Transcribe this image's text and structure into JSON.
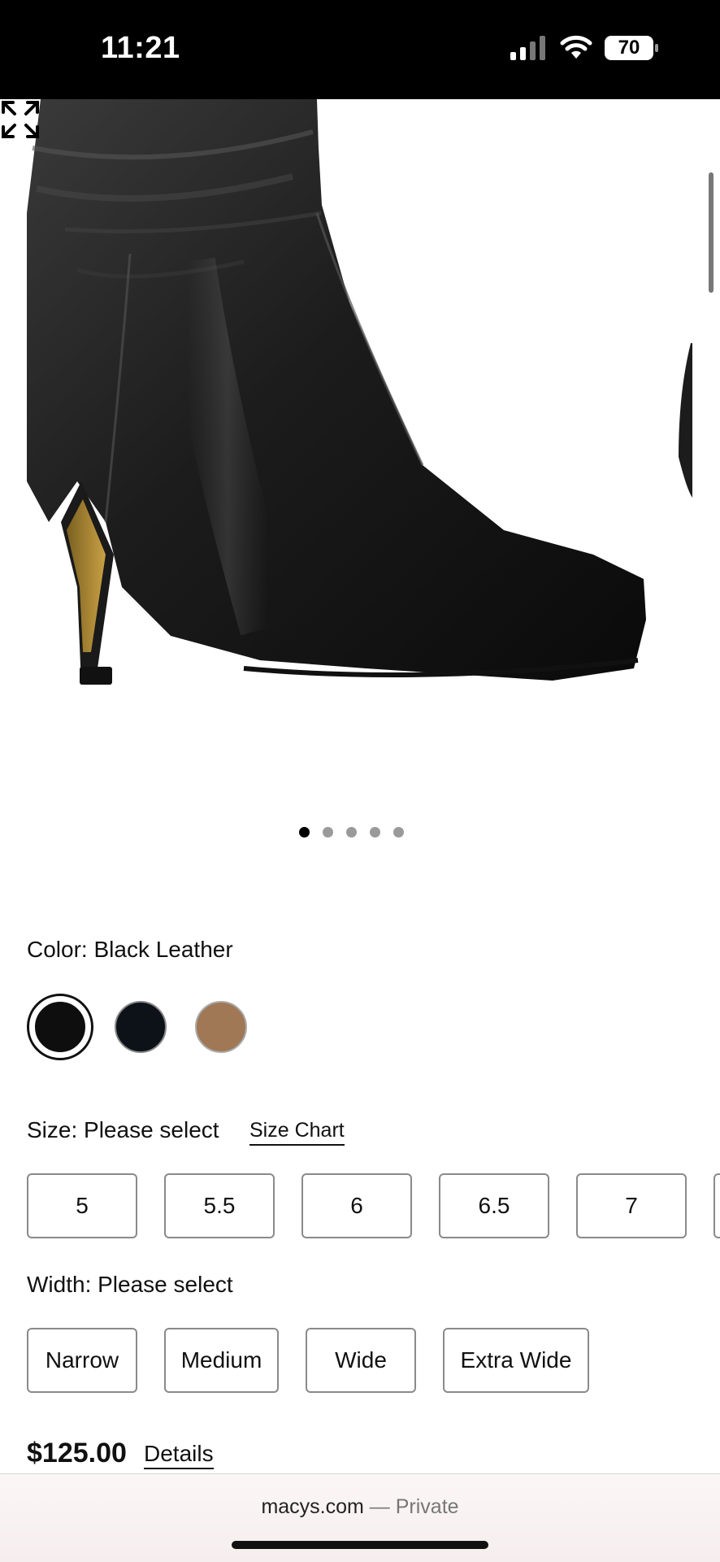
{
  "status": {
    "time": "11:21",
    "battery": "70"
  },
  "gallery": {
    "total_images": 5,
    "active_index": 0
  },
  "color": {
    "label": "Color: Black Leather"
  },
  "swatch_colors": [
    "#0e0e0e",
    "#0d1118",
    "#a07856"
  ],
  "size": {
    "label": "Size: Please select",
    "chart_link": "Size Chart",
    "options": [
      "5",
      "5.5",
      "6",
      "6.5",
      "7"
    ]
  },
  "width": {
    "label": "Width: Please select",
    "options": [
      "Narrow",
      "Medium",
      "Wide",
      "Extra Wide"
    ]
  },
  "price": {
    "amount": "$125.00",
    "details_link": "Details"
  },
  "browser": {
    "domain": "macys.com",
    "separator": "—",
    "mode": "Private"
  }
}
